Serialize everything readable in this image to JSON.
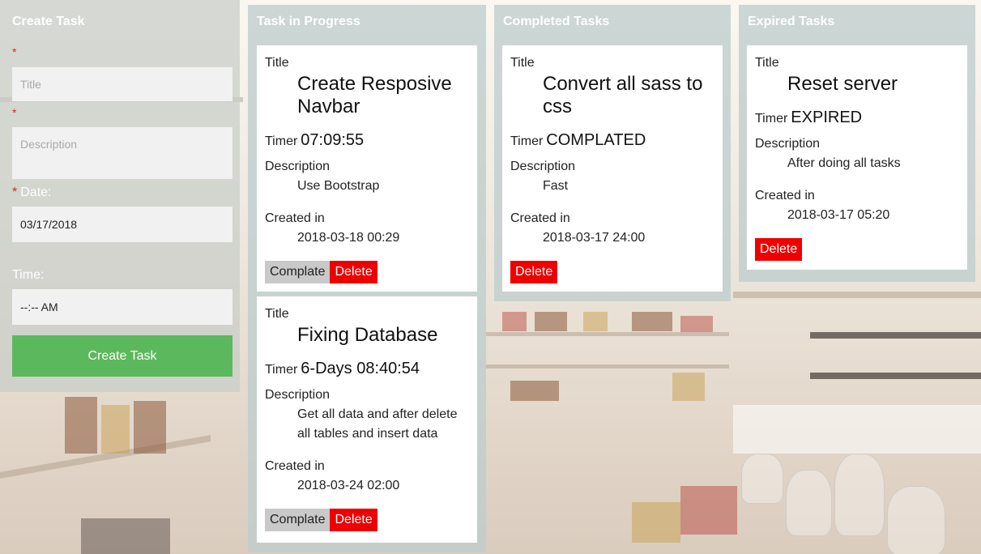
{
  "create": {
    "title": "Create Task",
    "required_mark": "*",
    "title_placeholder": "Title",
    "description_placeholder": "Description",
    "date_label": "Date:",
    "date_value": "03/17/2018",
    "time_label": "Time:",
    "time_value": "--:-- AM",
    "submit_label": "Create Task"
  },
  "columns": {
    "progress": "Task in Progress",
    "completed": "Completed Tasks",
    "expired": "Expired Tasks"
  },
  "labels": {
    "title": "Title",
    "timer": "Timer",
    "description": "Description",
    "created_in": "Created in",
    "complete": "Complate",
    "delete": "Delete"
  },
  "progress_tasks": [
    {
      "title_line1": "Create Resposive",
      "title_line2": "Navbar",
      "timer": "07:09:55",
      "description": "Use Bootstrap",
      "created": "2018-03-18 00:29"
    },
    {
      "title_line1": "Fixing Database",
      "timer": "6-Days 08:40:54",
      "description_line1": "Get all data and after delete",
      "description_line2": "all tables and insert data",
      "created": "2018-03-24 02:00"
    }
  ],
  "completed_tasks": [
    {
      "title_line1": "Convert all sass to",
      "title_line2": "css",
      "timer": "COMPLATED",
      "description": "Fast",
      "created": "2018-03-17 24:00"
    }
  ],
  "expired_tasks": [
    {
      "title_line1": "Reset server",
      "timer": "EXPIRED",
      "description": "After doing all tasks",
      "created": "2018-03-17 05:20"
    }
  ]
}
